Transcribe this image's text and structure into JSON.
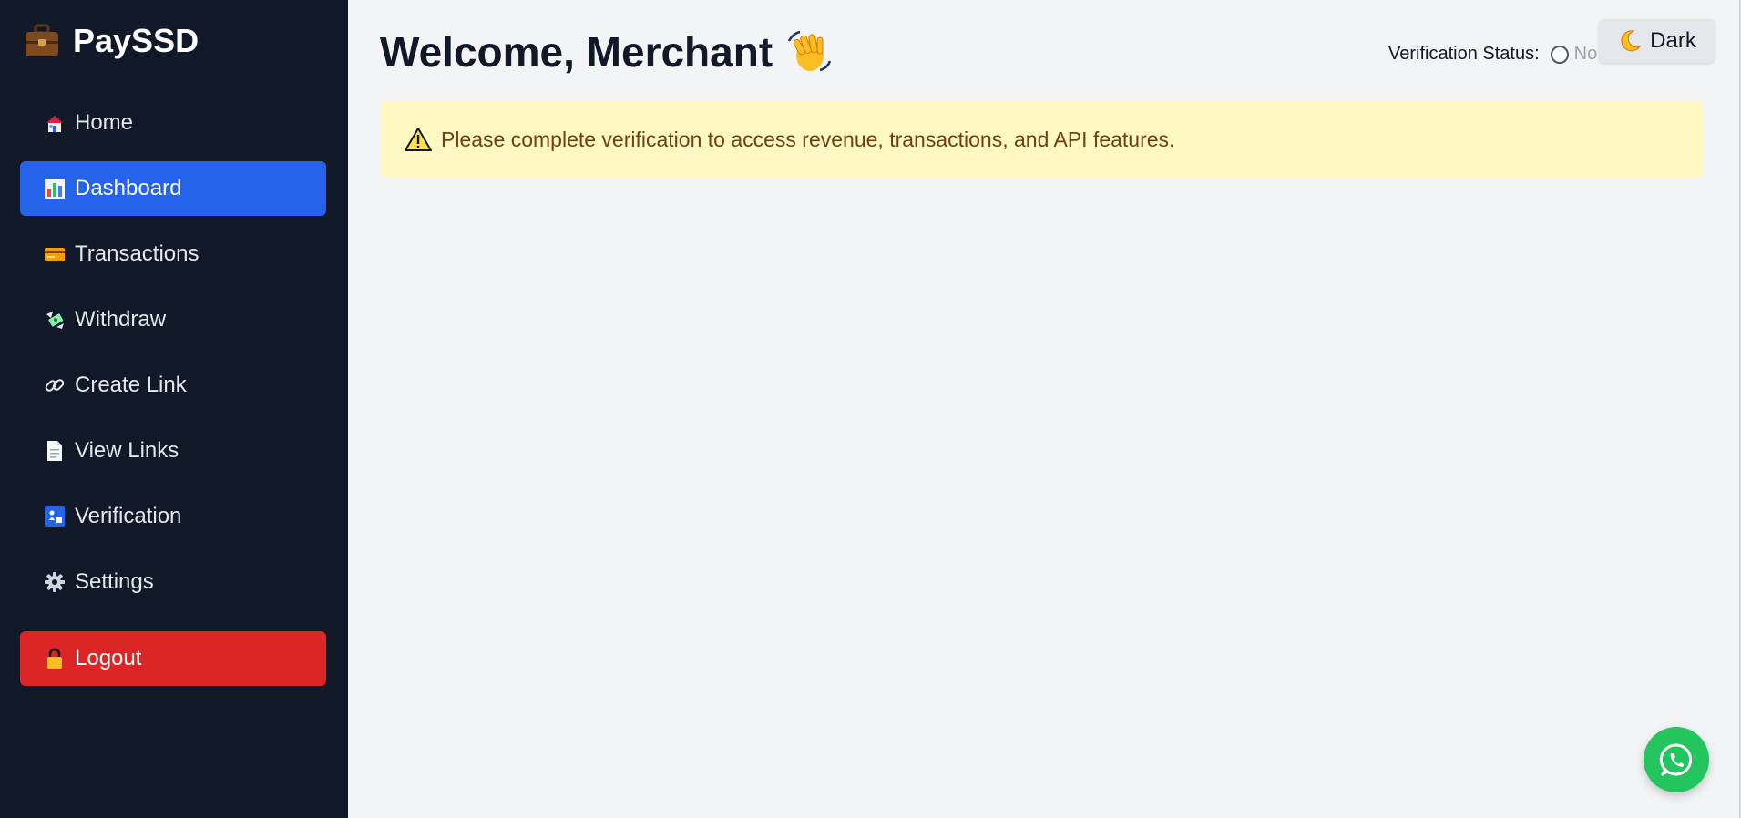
{
  "sidebar": {
    "brand": "PaySSD",
    "items": [
      {
        "label": "Home",
        "icon": "home-icon"
      },
      {
        "label": "Dashboard",
        "icon": "bar-chart-icon",
        "active": true
      },
      {
        "label": "Transactions",
        "icon": "credit-card-icon"
      },
      {
        "label": "Withdraw",
        "icon": "money-wings-icon"
      },
      {
        "label": "Create Link",
        "icon": "link-icon"
      },
      {
        "label": "View Links",
        "icon": "document-icon"
      },
      {
        "label": "Verification",
        "icon": "passport-control-icon"
      },
      {
        "label": "Settings",
        "icon": "gear-icon"
      }
    ],
    "logout_label": "Logout"
  },
  "header": {
    "title": "Welcome, Merchant",
    "verification_label": "Verification Status:",
    "verification_value": "No",
    "theme_toggle_label": "Dark"
  },
  "alert": {
    "message": "Please complete verification to access revenue, transactions, and API features."
  },
  "colors": {
    "sidebar_bg": "#111827",
    "active": "#2563eb",
    "logout": "#dc2626",
    "alert_bg": "#fef9c3",
    "alert_text": "#713f12",
    "whatsapp": "#22c55e"
  }
}
